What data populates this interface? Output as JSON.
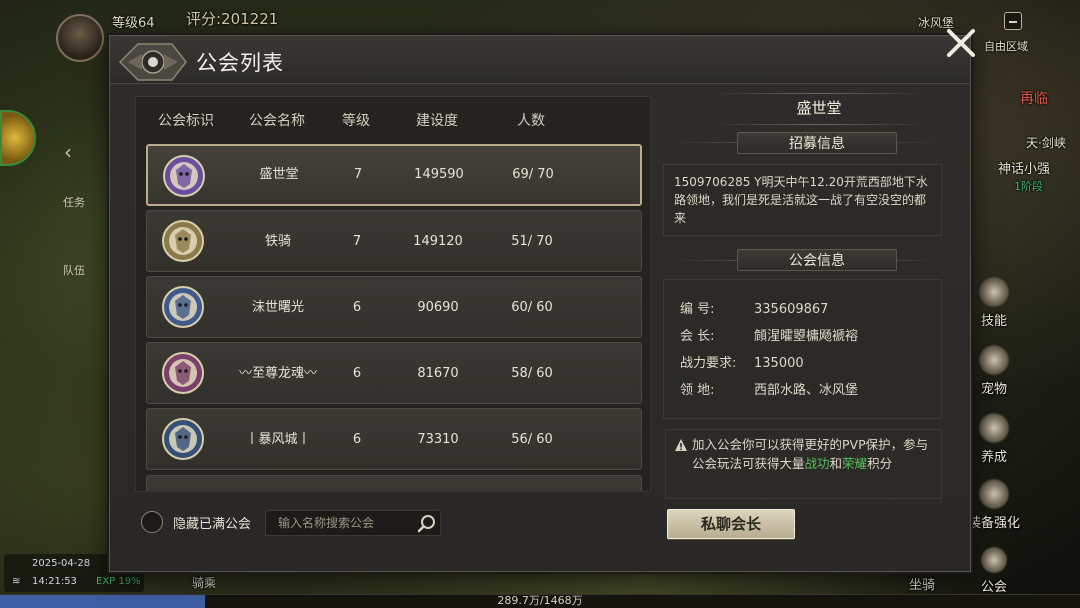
{
  "hud": {
    "level": "等级64",
    "score": "评分:201221",
    "location": "冰风堡",
    "zone": "自由区域",
    "top_banner": "冰风堡",
    "side_tabs": [
      "任务",
      "队伍"
    ],
    "right_menu": [
      "技能",
      "宠物",
      "养成",
      "装备强化",
      "坐骑",
      "公会"
    ],
    "right_top_labels": [
      "再临",
      "天·剑峡",
      "神话小强",
      "1阶段"
    ],
    "date": "2025-04-28",
    "time": "14:21:53",
    "exp_label": "EXP 19%",
    "exp_progress": 0.19,
    "mount_label": "骑乘",
    "progress_text": "289.7万/1468万"
  },
  "panel": {
    "title": "公会列表",
    "columns": [
      "公会标识",
      "公会名称",
      "等级",
      "建设度",
      "人数"
    ],
    "guilds": [
      {
        "name": "盛世堂",
        "level": "7",
        "construction": "149590",
        "members": "69/ 70",
        "badge_color": "#6a4fa0"
      },
      {
        "name": "铁骑",
        "level": "7",
        "construction": "149120",
        "members": "51/ 70",
        "badge_color": "#8a7a4a"
      },
      {
        "name": "沫世曙光",
        "level": "6",
        "construction": "90690",
        "members": "60/ 60",
        "badge_color": "#3f5a8a"
      },
      {
        "name": "〰至尊龙魂〰",
        "level": "6",
        "construction": "81670",
        "members": "58/ 60",
        "badge_color": "#7a3f6a"
      },
      {
        "name": "丨暴风城丨",
        "level": "6",
        "construction": "73310",
        "members": "56/ 60",
        "badge_color": "#34507a"
      }
    ],
    "hide_full_label": "隐藏已满公会",
    "search_placeholder": "输入名称搜索公会",
    "selected_guild_name": "盛世堂",
    "recruit_title": "招募信息",
    "recruit_text": "1509706285 Y明天中午12.20开荒西部地下水路领地，我们是死是活就这一战了有空没空的都来",
    "info_title": "公会信息",
    "info": [
      {
        "key": "编      号:",
        "value": "335609867"
      },
      {
        "key": "会      长:",
        "value": "頠湦曤曌槦飏褫褣"
      },
      {
        "key": "战力要求:",
        "value": "135000"
      },
      {
        "key": "领      地:",
        "value": "西部水路、冰风堡"
      }
    ],
    "notice_prefix": "加入公会你可以获得更好的PVP保护，参与公会玩法可获得大量",
    "notice_hl1": "战功",
    "notice_mid": "和",
    "notice_hl2": "荣耀",
    "notice_suffix": "积分",
    "chat_button": "私聊会长"
  },
  "colors": {
    "highlight_green": "#56c05a",
    "button_beige": "#dcd3bb",
    "panel_bg": "#2f2d2a"
  }
}
